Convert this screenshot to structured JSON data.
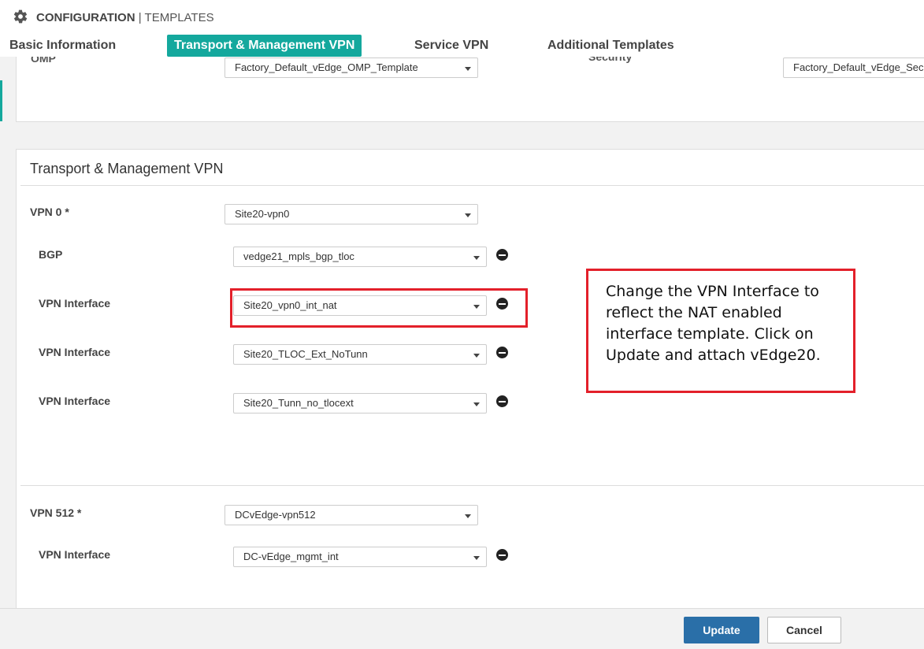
{
  "header": {
    "section": "CONFIGURATION",
    "separator": "|",
    "page": "TEMPLATES",
    "icon": "gear-icon"
  },
  "tabs": [
    {
      "label": "Basic Information",
      "active": false
    },
    {
      "label": "Transport & Management VPN",
      "active": true
    },
    {
      "label": "Service VPN",
      "active": false
    },
    {
      "label": "Additional Templates",
      "active": false
    }
  ],
  "top_card": {
    "omp_label": "OMP",
    "omp_value": "Factory_Default_vEdge_OMP_Template",
    "security_label": "Security",
    "security_value": "Factory_Default_vEdge_Secu"
  },
  "transport_section": {
    "title": "Transport & Management VPN",
    "vpn0": {
      "label": "VPN 0 *",
      "value": "Site20-vpn0",
      "children": [
        {
          "label": "BGP",
          "value": "vedge21_mpls_bgp_tloc"
        },
        {
          "label": "VPN Interface",
          "value": "Site20_vpn0_int_nat"
        },
        {
          "label": "VPN Interface",
          "value": "Site20_TLOC_Ext_NoTunn"
        },
        {
          "label": "VPN Interface",
          "value": "Site20_Tunn_no_tlocext"
        }
      ]
    },
    "vpn512": {
      "label": "VPN 512 *",
      "value": "DCvEdge-vpn512",
      "children": [
        {
          "label": "VPN Interface",
          "value": "DC-vEdge_mgmt_int"
        }
      ]
    }
  },
  "annotation": {
    "text": "Change the VPN Interface to reflect the NAT enabled interface template. Click on Update and attach vEdge20.",
    "color": "#e3202a"
  },
  "footer": {
    "update_label": "Update",
    "cancel_label": "Cancel"
  },
  "colors": {
    "accent": "#14a89d",
    "primary_button": "#2a6fa8"
  }
}
